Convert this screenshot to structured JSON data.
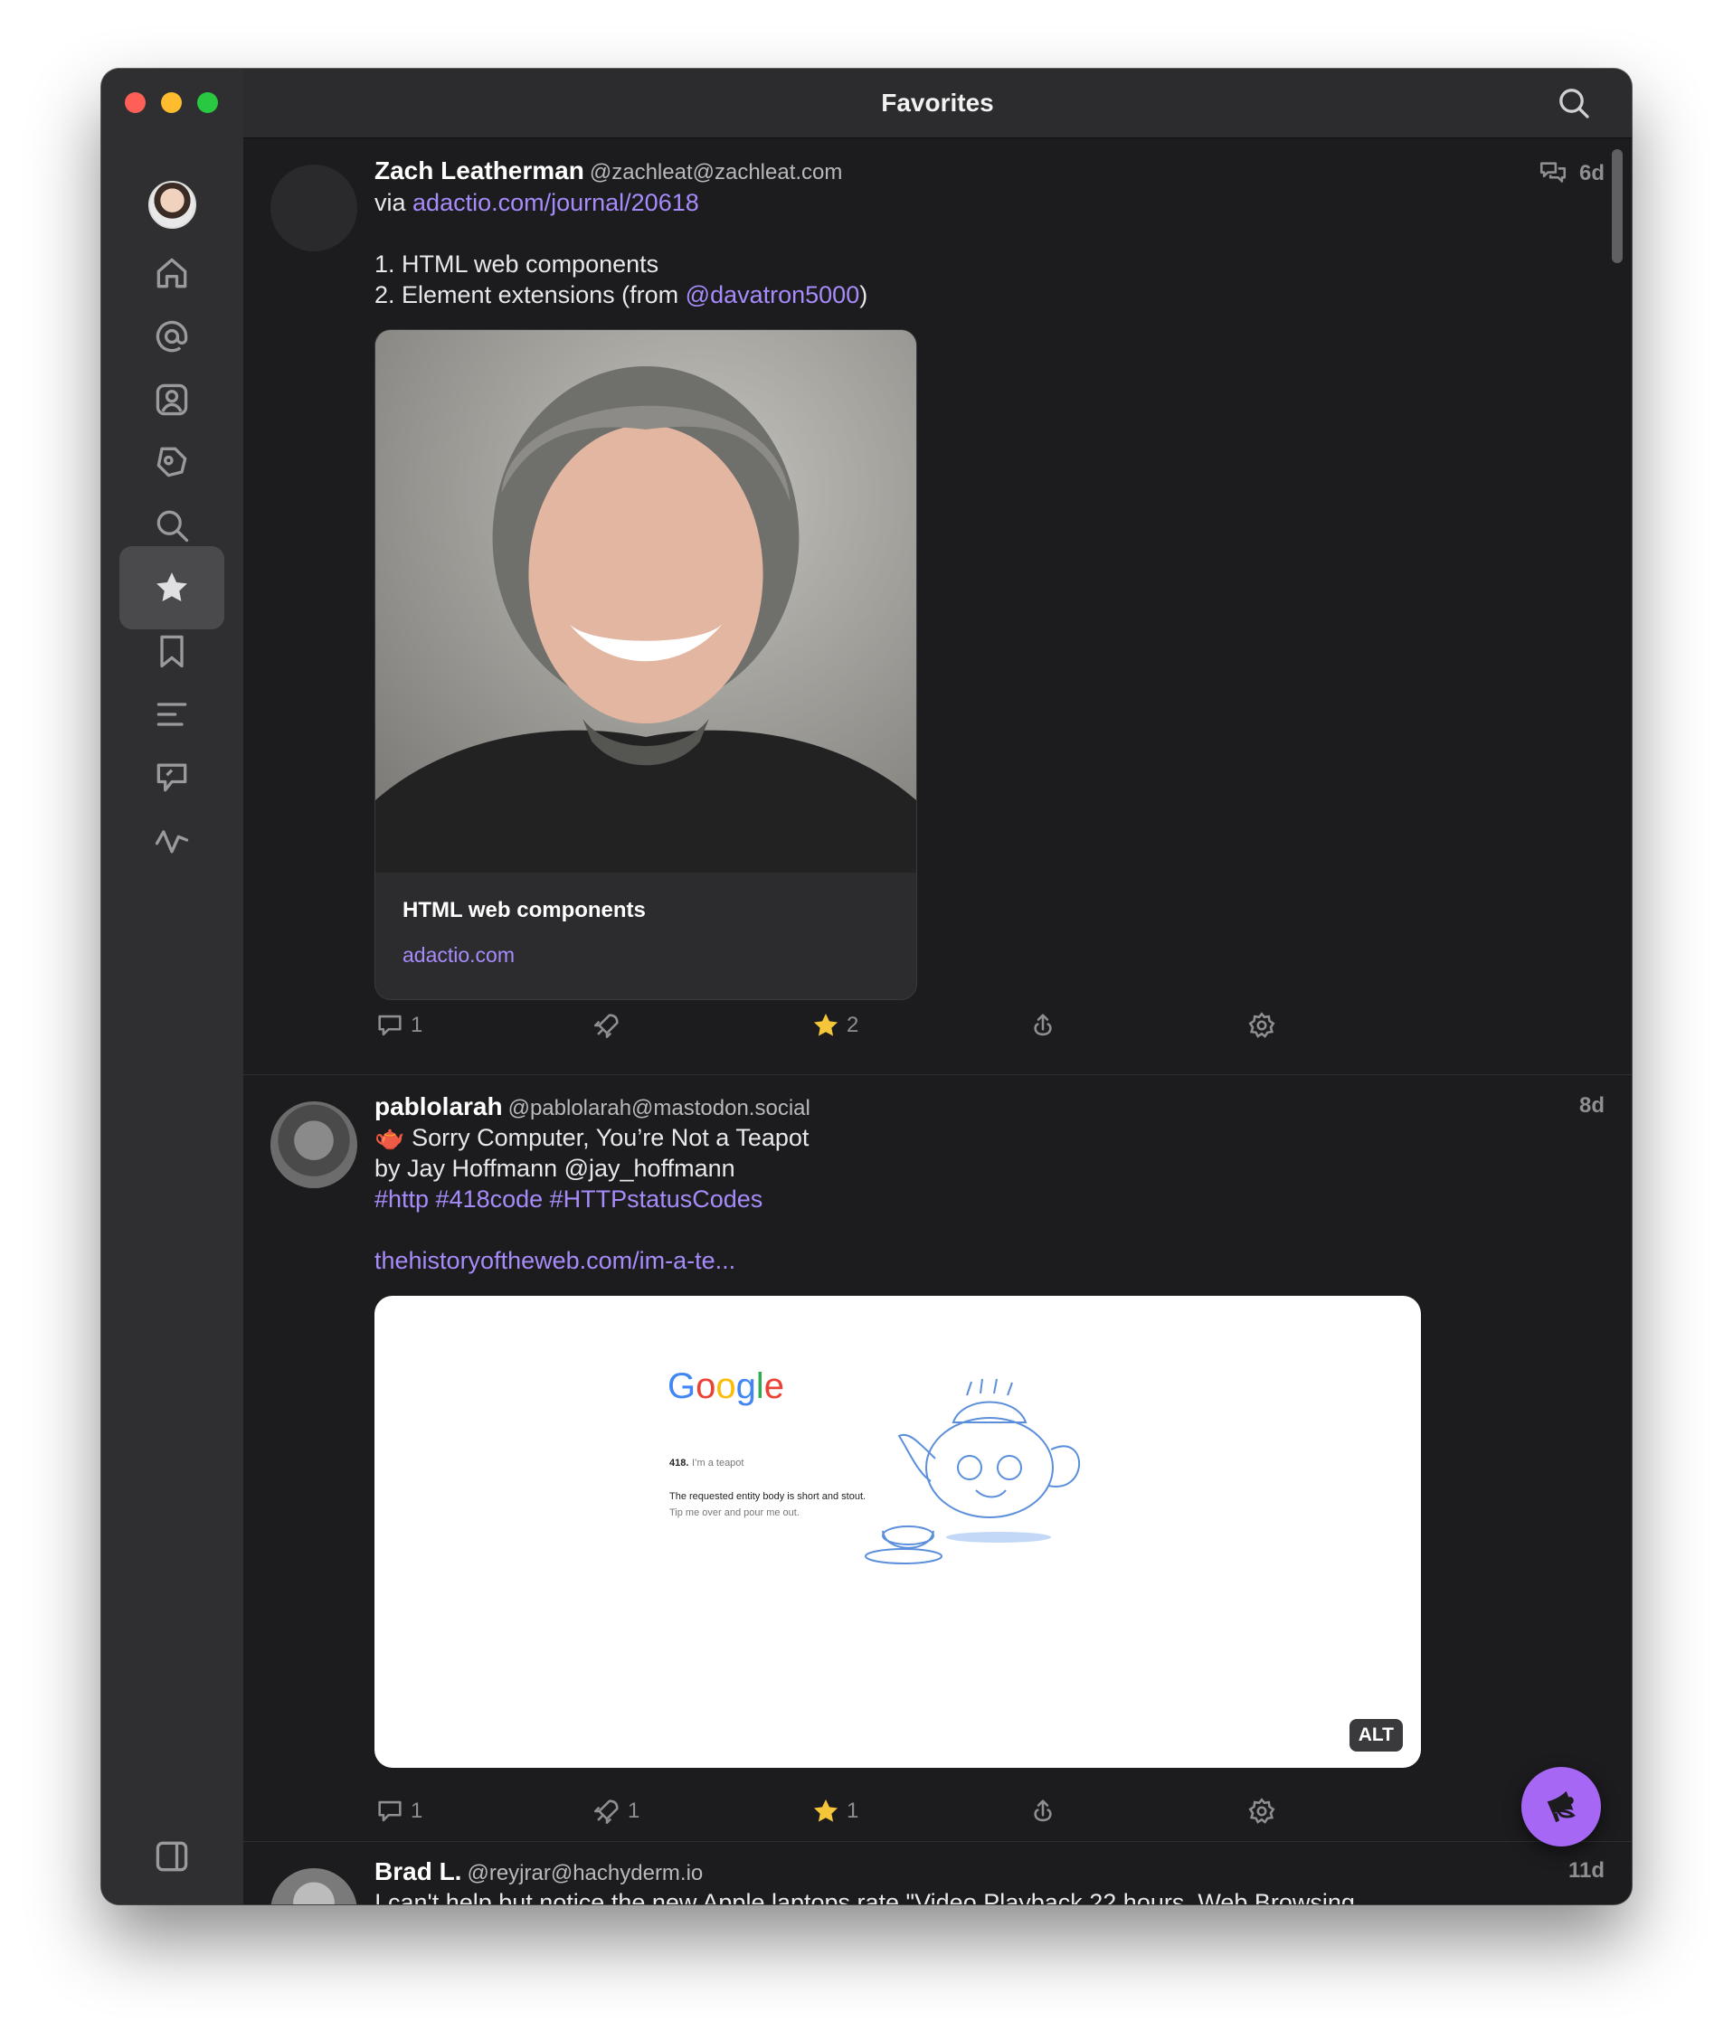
{
  "window": {
    "title": "Favorites"
  },
  "sidebar": {
    "items": [
      {
        "name": "home",
        "icon": "home-icon"
      },
      {
        "name": "mentions",
        "icon": "at-icon"
      },
      {
        "name": "profile",
        "icon": "person-icon"
      },
      {
        "name": "explore",
        "icon": "explore-icon"
      },
      {
        "name": "search",
        "icon": "search-icon"
      },
      {
        "name": "favorites",
        "icon": "star-icon",
        "active": true
      },
      {
        "name": "bookmarks",
        "icon": "bookmark-icon"
      },
      {
        "name": "lists",
        "icon": "list-icon"
      },
      {
        "name": "messages",
        "icon": "message-icon"
      },
      {
        "name": "activity",
        "icon": "activity-icon"
      }
    ],
    "toggle_icon": "sidebar-toggle-icon"
  },
  "accent": "#a78bfa",
  "posts": [
    {
      "name": "Zach Leatherman",
      "handle": "@zachleat@zachleat.com",
      "time": "6d",
      "via_label": "via",
      "via_link": "adactio.com/journal/20618",
      "line1": "1. HTML web components",
      "line2_prefix": "2. Element extensions (from",
      "line2_mention": "@davatron5000",
      "line2_suffix": ")",
      "card": {
        "title": "HTML web components",
        "domain": "adactio.com"
      },
      "counts": {
        "replies": "1",
        "boosts": "",
        "favorites": "2"
      }
    },
    {
      "name": "pablolarah",
      "handle": "@pablolarah@mastodon.social",
      "time": "8d",
      "line1": "🫖 Sorry Computer, You’re Not a Teapot",
      "line2": "by Jay Hoffmann @jay_hoffmann",
      "tags": "#http #418code #HTTPstatusCodes",
      "link": "thehistoryoftheweb.com/im-a-te...",
      "media": {
        "logo": "Google",
        "code": "418.",
        "status": "I’m a teapot",
        "body1": "The requested entity body is short and stout.",
        "body2": "Tip me over and pour me out.",
        "alt": "ALT"
      },
      "counts": {
        "replies": "1",
        "boosts": "1",
        "favorites": "1"
      }
    },
    {
      "name": "Brad L.",
      "handle": "@reyjrar@hachyderm.io",
      "time": "11d",
      "line1": "I can't help but notice the new Apple laptops rate \"Video Playback 22 hours, Web Browsing"
    }
  ]
}
